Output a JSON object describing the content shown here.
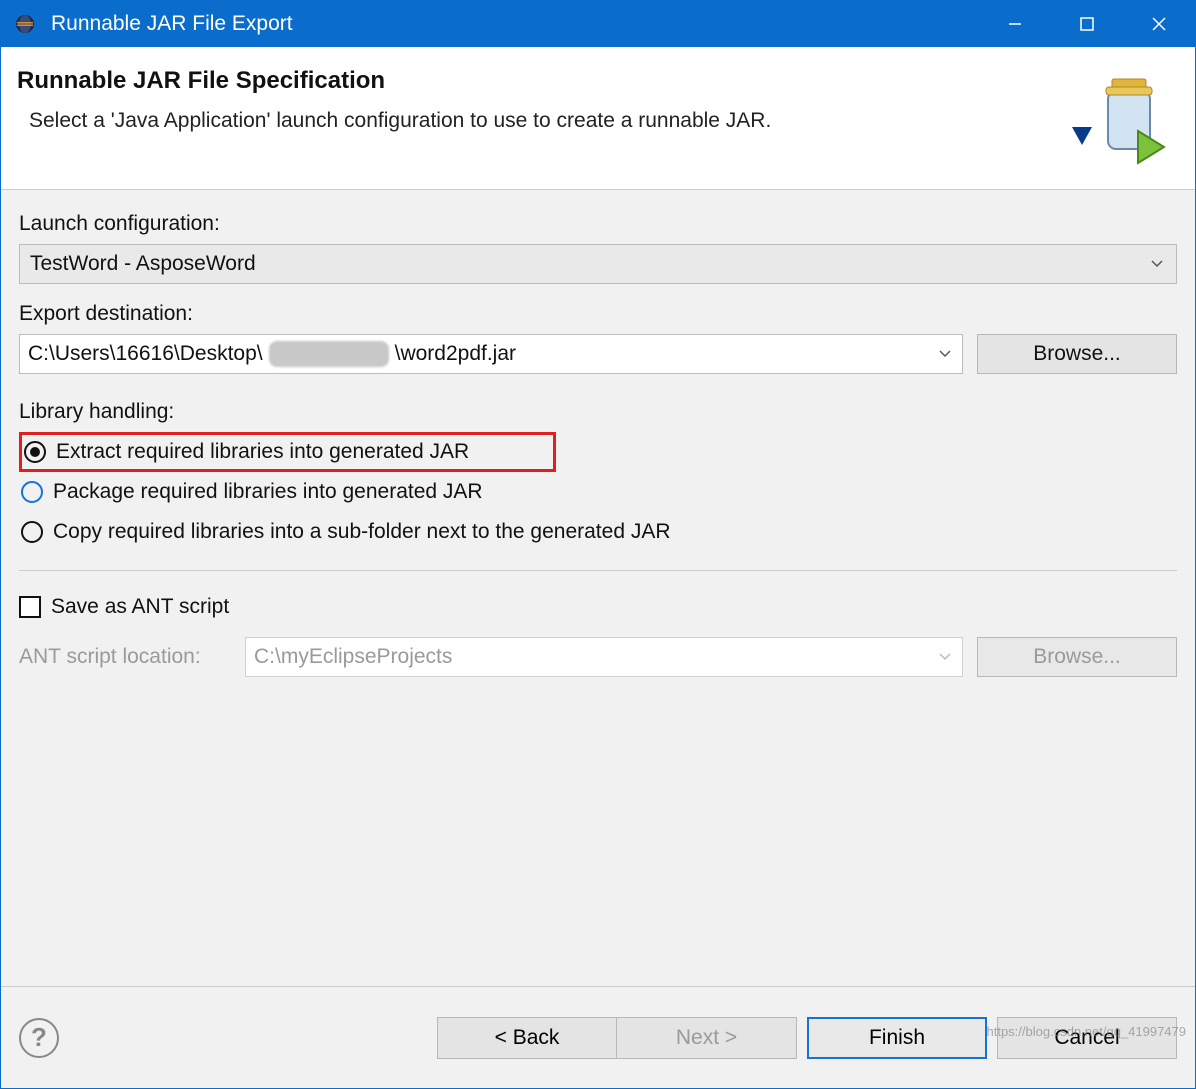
{
  "window": {
    "title": "Runnable JAR File Export"
  },
  "header": {
    "title": "Runnable JAR File Specification",
    "subtitle": "Select a 'Java Application' launch configuration to use to create a runnable JAR."
  },
  "launch_config": {
    "label": "Launch configuration:",
    "value": "TestWord - AsposeWord"
  },
  "export_dest": {
    "label": "Export destination:",
    "path_prefix": "C:\\Users\\16616\\Desktop\\",
    "path_suffix": "\\word2pdf.jar",
    "browse_label": "Browse..."
  },
  "library": {
    "label": "Library handling:",
    "options": {
      "extract": "Extract required libraries into generated JAR",
      "package": "Package required libraries into generated JAR",
      "copy": "Copy required libraries into a sub-folder next to the generated JAR"
    },
    "selected": "extract"
  },
  "ant": {
    "save_label": "Save as ANT script",
    "loc_label": "ANT script location:",
    "loc_value": "C:\\myEclipseProjects",
    "browse_label": "Browse..."
  },
  "footer": {
    "back": "< Back",
    "next": "Next >",
    "finish": "Finish",
    "cancel": "Cancel"
  },
  "watermark": "https://blog.csdn.net/qq_41997479"
}
